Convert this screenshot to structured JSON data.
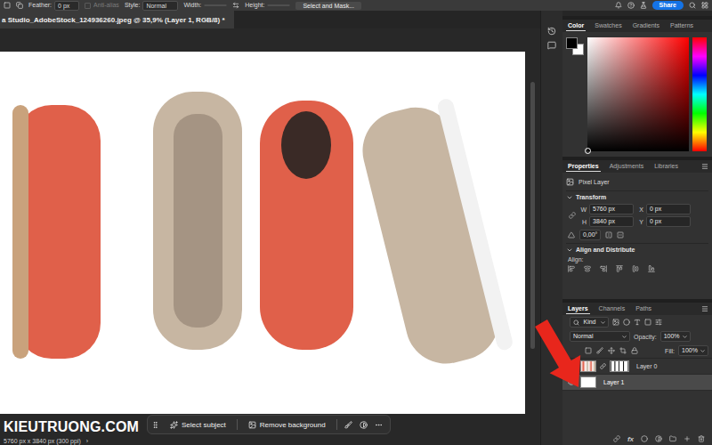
{
  "options_bar": {
    "feather_label": "Feather:",
    "feather_value": "0 px",
    "anti_alias": {
      "label": "Anti-alias",
      "disabled": true
    },
    "style_label": "Style:",
    "style_value": "Normal",
    "width_label": "Width:",
    "height_label": "Height:",
    "select_mask": "Select and Mask...",
    "share": "Share"
  },
  "document_tab": {
    "title": "a Studio_AdobeStock_124936260.jpeg @ 35,9% (Layer 1, RGB/8) *"
  },
  "task_bar": {
    "buttons": [
      "Select subject",
      "Remove background"
    ]
  },
  "status_bar": {
    "text": "5760 px x 3840 px (300 ppi)",
    "arrow": "›"
  },
  "watermark": "KIEUTRUONG.COM",
  "color_panel": {
    "tabs": [
      {
        "label": "Color",
        "selected": true
      },
      {
        "label": "Swatches",
        "selected": false
      },
      {
        "label": "Gradients",
        "selected": false
      },
      {
        "label": "Patterns",
        "selected": false
      }
    ]
  },
  "properties_panel": {
    "tabs": [
      {
        "label": "Properties",
        "selected": true
      },
      {
        "label": "Adjustments",
        "selected": false
      },
      {
        "label": "Libraries",
        "selected": false
      }
    ],
    "layer_kind": "Pixel Layer",
    "transform": {
      "title": "Transform",
      "rows": [
        {
          "label": "W",
          "value": "5760 px",
          "label2": "X",
          "value2": "0 px"
        },
        {
          "label": "H",
          "value": "3840 px",
          "label2": "Y",
          "value2": "0 px"
        }
      ],
      "angle": "0,00°"
    },
    "align": {
      "title": "Align and Distribute",
      "label": "Align:"
    }
  },
  "layers_panel": {
    "tabs": [
      {
        "label": "Layers",
        "selected": true
      },
      {
        "label": "Channels",
        "selected": false
      },
      {
        "label": "Paths",
        "selected": false
      }
    ],
    "filter": "Kind",
    "blend_mode": "Normal",
    "opacity_label": "Opacity:",
    "opacity": "100%",
    "fill_label": "Fill:",
    "fill": "100%",
    "layers": [
      {
        "name": "Layer 0",
        "kind": "photo",
        "has_mask": true,
        "visible": false,
        "selected": false
      },
      {
        "name": "Layer 1",
        "kind": "fill",
        "has_mask": false,
        "visible": true,
        "selected": true
      }
    ],
    "footer_fx": "fx"
  }
}
